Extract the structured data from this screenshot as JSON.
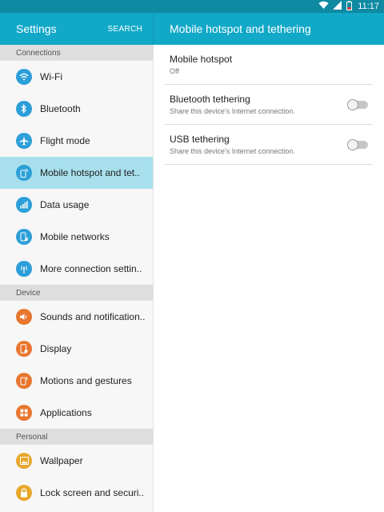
{
  "status_bar": {
    "time": "11:17",
    "icons": [
      "wifi-icon",
      "signal-icon",
      "battery-icon"
    ]
  },
  "header": {
    "left_title": "Settings",
    "search_label": "SEARCH",
    "right_title": "Mobile hotspot and tethering"
  },
  "sidebar": {
    "sections": [
      {
        "title": "Connections",
        "items": [
          {
            "label": "Wi-Fi",
            "icon": "wifi-icon",
            "color": "#2d9fd8"
          },
          {
            "label": "Bluetooth",
            "icon": "bluetooth-icon",
            "color": "#2d9fd8"
          },
          {
            "label": "Flight mode",
            "icon": "airplane-icon",
            "color": "#2d9fd8"
          },
          {
            "label": "Mobile hotspot and tet..",
            "icon": "hotspot-icon",
            "color": "#2d9fd8",
            "active": true
          },
          {
            "label": "Data usage",
            "icon": "data-usage-icon",
            "color": "#2d9fd8"
          },
          {
            "label": "Mobile networks",
            "icon": "mobile-networks-icon",
            "color": "#2d9fd8"
          },
          {
            "label": "More connection settin..",
            "icon": "more-connection-icon",
            "color": "#2d9fd8"
          }
        ]
      },
      {
        "title": "Device",
        "items": [
          {
            "label": "Sounds and notification..",
            "icon": "sound-icon",
            "color": "#e8762e"
          },
          {
            "label": "Display",
            "icon": "display-icon",
            "color": "#e8762e"
          },
          {
            "label": "Motions and gestures",
            "icon": "motion-icon",
            "color": "#e8762e"
          },
          {
            "label": "Applications",
            "icon": "applications-icon",
            "color": "#e8762e"
          }
        ]
      },
      {
        "title": "Personal",
        "items": [
          {
            "label": "Wallpaper",
            "icon": "wallpaper-icon",
            "color": "#e7a82d"
          },
          {
            "label": "Lock screen and securi..",
            "icon": "lock-icon",
            "color": "#e7a82d"
          }
        ]
      }
    ]
  },
  "main": {
    "rows": [
      {
        "title": "Mobile hotspot",
        "subtitle": "Off",
        "toggle": false
      },
      {
        "title": "Bluetooth tethering",
        "subtitle": "Share this device's Internet connection.",
        "toggle": false
      },
      {
        "title": "USB tethering",
        "subtitle": "Share this device's Internet connection.",
        "toggle": false
      }
    ]
  },
  "colors": {
    "accent": "#12a8c8",
    "status_bar": "#0e8aa3",
    "active_item": "#a7e0ec"
  }
}
